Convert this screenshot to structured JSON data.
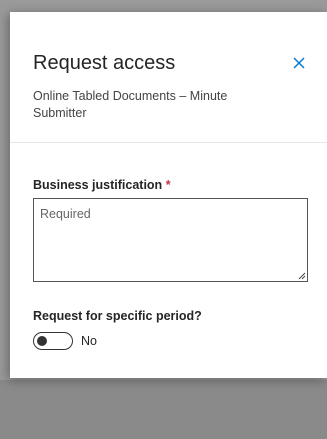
{
  "dialog": {
    "title": "Request access",
    "subtitle": "Online Tabled Documents – Minute Submitter",
    "close_icon": "close-icon"
  },
  "form": {
    "justification": {
      "label": "Business justification",
      "required_marker": "*",
      "placeholder": "Required",
      "value": ""
    },
    "specific_period": {
      "label": "Request for specific period?",
      "toggle_state": "No",
      "checked": false
    }
  },
  "colors": {
    "required_marker": "#c4314b",
    "close_icon": "#0078d4"
  }
}
